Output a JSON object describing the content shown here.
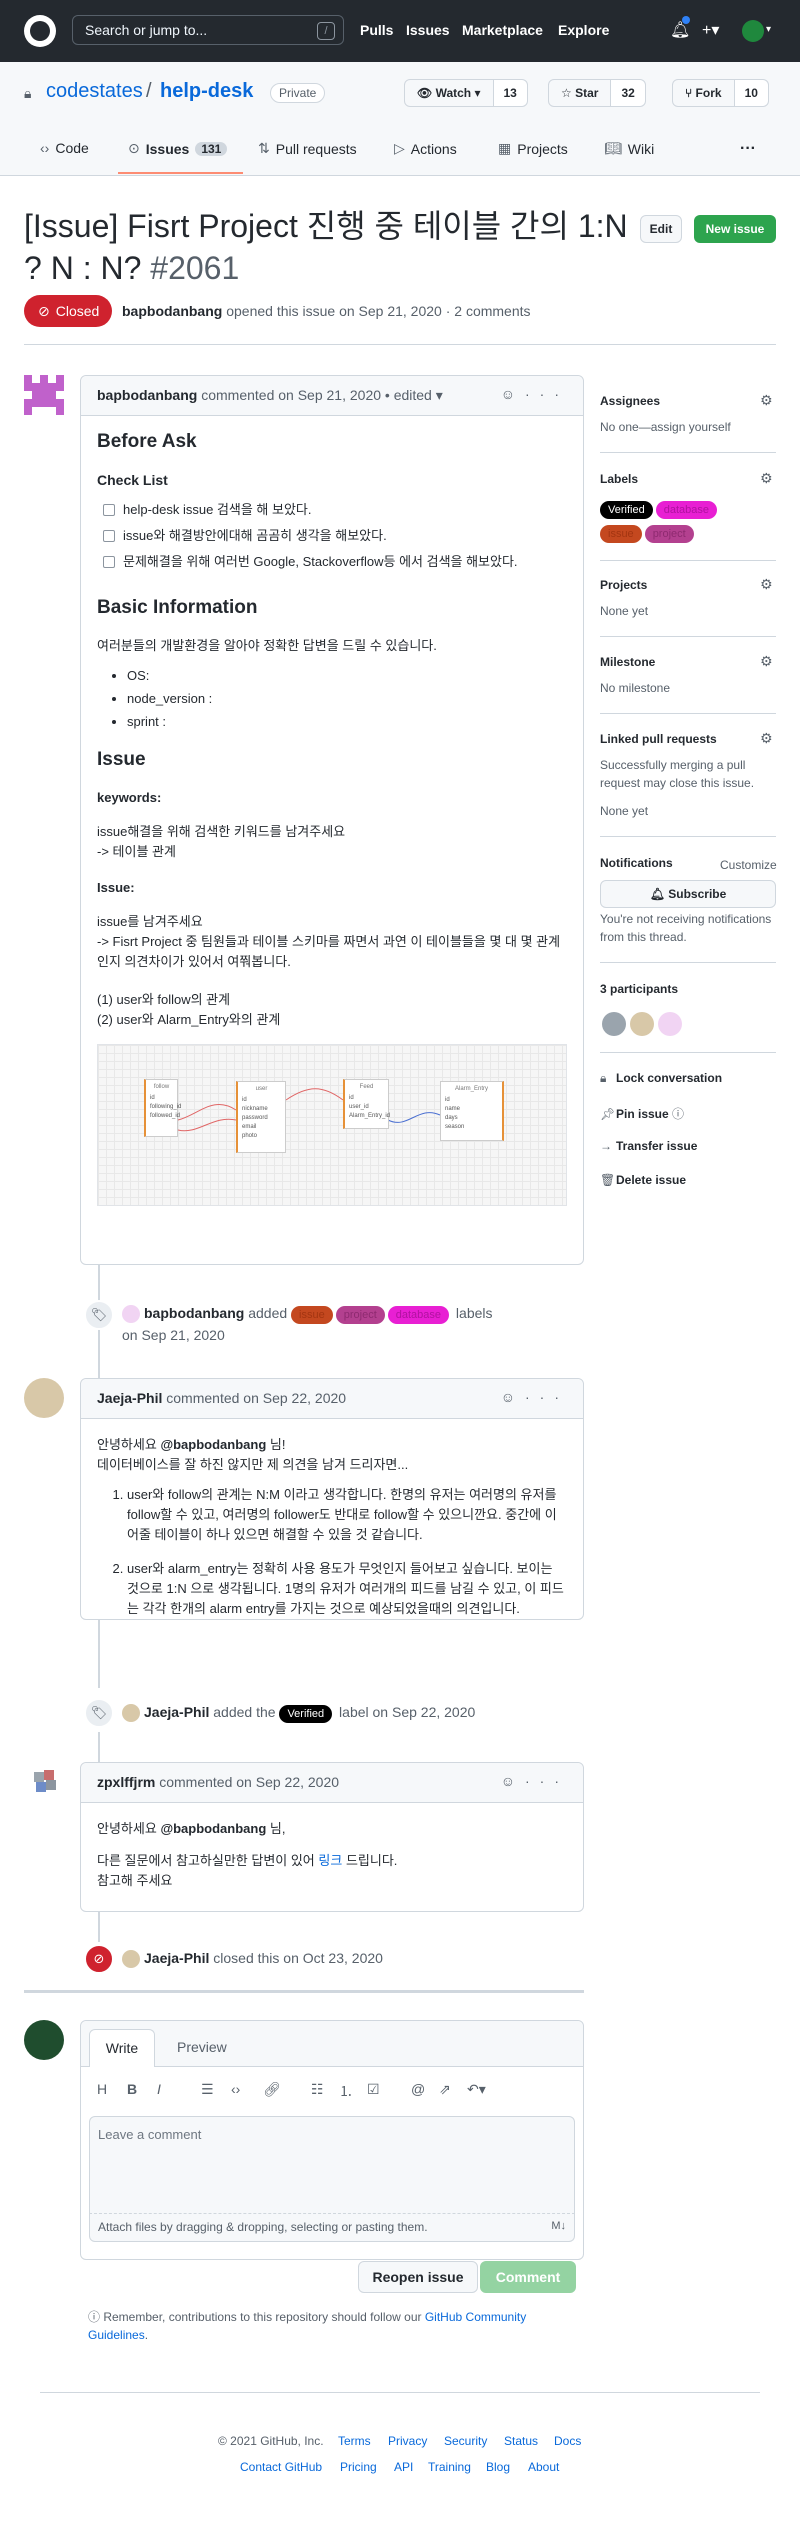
{
  "header": {
    "search_placeholder": "Search or jump to...",
    "search_shortcut": "/",
    "nav": [
      "Pulls",
      "Issues",
      "Marketplace",
      "Explore"
    ]
  },
  "repo": {
    "owner": "codestates",
    "separator": "/",
    "name": "help-desk",
    "visibility": "Private",
    "watch_label": "Watch",
    "watch_count": "13",
    "star_label": "Star",
    "star_count": "32",
    "fork_label": "Fork",
    "fork_count": "10"
  },
  "tabs": [
    {
      "label": "Code"
    },
    {
      "label": "Issues",
      "count": "131"
    },
    {
      "label": "Pull requests"
    },
    {
      "label": "Actions"
    },
    {
      "label": "Projects"
    },
    {
      "label": "Wiki"
    }
  ],
  "issue": {
    "title": "[Issue] Fisrt Project 진행 중 테이블 간의 1:N ? N : N?",
    "number": "#2061",
    "edit_label": "Edit",
    "new_issue_label": "New issue",
    "state": "Closed",
    "author": "bapbodanbang",
    "meta": "opened this issue on Sep 21, 2020 · 2 comments"
  },
  "first_comment": {
    "author": "bapbodanbang",
    "meta": "commented on Sep 21, 2020 • edited",
    "before_ask": "Before Ask",
    "check_list": "Check List",
    "tasks": [
      "help-desk issue 검색을 해 보았다.",
      "issue와 해결방안에대해 곰곰히 생각을 해보았다.",
      "문제해결을 위해 여러번 Google, Stackoverflow등 에서 검색을 해보았다."
    ],
    "basic_info": "Basic Information",
    "basic_desc": "여러분들의 개발환경을 알아야 정확한 답변을 드릴 수 있습니다.",
    "env": [
      "OS:",
      "node_version :",
      "sprint :"
    ],
    "issue_heading": "Issue",
    "keywords_heading": "keywords:",
    "keywords_line1": "issue해결을 위해 검색한 키워드를 남겨주세요",
    "keywords_line2": "-> 테이블 관계",
    "issue_sub": "Issue:",
    "issue_line1": "issue를 남겨주세요",
    "issue_line2": "-> Fisrt Project 중 팀원들과 테이블 스키마를 짜면서 과연 이 테이블들을 몇 대 몇 관계인지 의견차이가 있어서 여쭤봅니다.",
    "rel1": "(1) user와 follow의 관계",
    "rel2": "(2) user와 Alarm_Entry와의 관계",
    "erd_tables": [
      {
        "name": "follow",
        "fields": [
          "id",
          "following_id",
          "followed_id"
        ]
      },
      {
        "name": "user",
        "fields": [
          "id",
          "nickname",
          "password",
          "email",
          "photo"
        ]
      },
      {
        "name": "Feed",
        "fields": [
          "id",
          "user_id",
          "Alarm_Entry_id"
        ]
      },
      {
        "name": "Alarm_Entry",
        "fields": [
          "id",
          "name",
          "days",
          "season"
        ]
      }
    ]
  },
  "event_labels": {
    "actor": "bapbodanbang",
    "verb": "added",
    "labels": [
      "issue",
      "project",
      "database"
    ],
    "suffix": "labels",
    "date": "on Sep 21, 2020"
  },
  "second_comment": {
    "author": "Jaeja-Phil",
    "meta": "commented on Sep 22, 2020",
    "greet_pre": "안녕하세요",
    "mention": "@bapbodanbang",
    "greet_post": "님!",
    "intro": "데이터베이스를 잘 하진 않지만 제 의견을 남겨 드리자면...",
    "points": [
      "user와 follow의 관계는 N:M 이라고 생각합니다. 한명의 유저는 여러명의 유저를 follow할 수 있고, 여러명의 follower도 반대로 follow할 수 있으니깐요. 중간에 이어줄 테이블이 하나 있으면 해결할 수 있을 것 같습니다.",
      "user와 alarm_entry는 정확히 사용 용도가 무엇인지 들어보고 싶습니다. 보이는 것으로 1:N 으로 생각됩니다. 1명의 유저가 여러개의 피드를 남길 수 있고, 이 피드는 각각 한개의 alarm entry를 가지는 것으로 예상되었을때의 의견입니다."
    ]
  },
  "event_verified": {
    "actor": "Jaeja-Phil",
    "pre": "added the",
    "label": "Verified",
    "post": "label on Sep 22, 2020"
  },
  "third_comment": {
    "author": "zpxlffjrm",
    "meta": "commented on Sep 22, 2020",
    "greet_pre": "안녕하세요",
    "mention": "@bapbodanbang",
    "greet_post": "님,",
    "line_pre": "다른 질문에서 참고하실만한 답변이 있어",
    "link": "링크",
    "line_post": "드립니다.",
    "line2": "참고해 주세요"
  },
  "event_closed": {
    "actor": "Jaeja-Phil",
    "text": "closed this on Oct 23, 2020"
  },
  "compose": {
    "tab_write": "Write",
    "tab_preview": "Preview",
    "placeholder": "Leave a comment",
    "attach_hint": "Attach files by dragging & dropping, selecting or pasting them.",
    "reopen_label": "Reopen issue",
    "comment_label": "Comment",
    "remember_text": "Remember, contributions to this repository should follow our",
    "remember_link": "GitHub Community Guidelines",
    "remember_end": "."
  },
  "sidebar": {
    "assignees_title": "Assignees",
    "assignees_value": "No one—assign yourself",
    "labels_title": "Labels",
    "labels": [
      {
        "name": "Verified",
        "bg": "#000000",
        "fg": "#ffffff"
      },
      {
        "name": "database",
        "bg": "#e81fd3",
        "fg": "#b012a0"
      },
      {
        "name": "issue",
        "bg": "#c4481f",
        "fg": "#a33511"
      },
      {
        "name": "project",
        "bg": "#b3408f",
        "fg": "#8e2a70"
      }
    ],
    "projects_title": "Projects",
    "projects_value": "None yet",
    "milestone_title": "Milestone",
    "milestone_value": "No milestone",
    "linked_title": "Linked pull requests",
    "linked_desc": "Successfully merging a pull request may close this issue.",
    "linked_value": "None yet",
    "notifications_title": "Notifications",
    "customize": "Customize",
    "subscribe_label": "Subscribe",
    "notif_desc": "You're not receiving notifications from this thread.",
    "participants": "3 participants",
    "lock": "Lock conversation",
    "pin": "Pin issue",
    "transfer": "Transfer issue",
    "delete": "Delete issue"
  },
  "footer": {
    "copyright": "© 2021 GitHub, Inc.",
    "row1": [
      "Terms",
      "Privacy",
      "Security",
      "Status",
      "Docs"
    ],
    "row2": [
      "Contact GitHub",
      "Pricing",
      "API",
      "Training",
      "Blog",
      "About"
    ]
  },
  "colors": {
    "header_bg": "#24292f",
    "closed_red": "#cf222e",
    "green": "#2da44e",
    "link_blue": "#0969da"
  }
}
